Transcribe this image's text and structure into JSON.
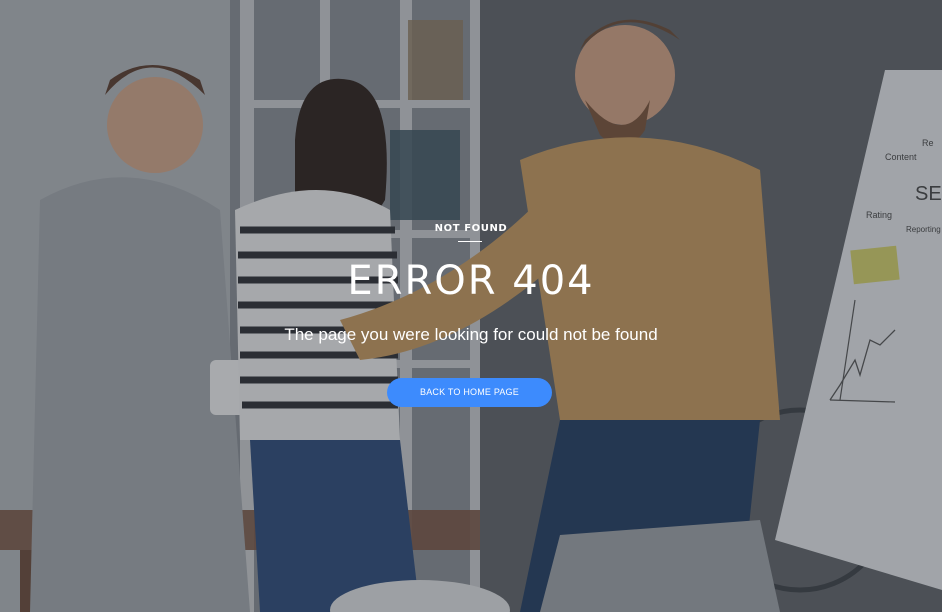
{
  "error_page": {
    "kicker": "NOT FOUND",
    "title": "ERROR 404",
    "subtitle": "The page you were looking for could not be found",
    "button_label": "BACK TO HOME PAGE"
  },
  "whiteboard": {
    "labels": [
      "Content",
      "Re",
      "SE",
      "Rating",
      "Reporting"
    ]
  },
  "colors": {
    "button": "#3d8bfd",
    "overlay": "rgba(45,50,58,0.38)",
    "text": "#ffffff"
  }
}
